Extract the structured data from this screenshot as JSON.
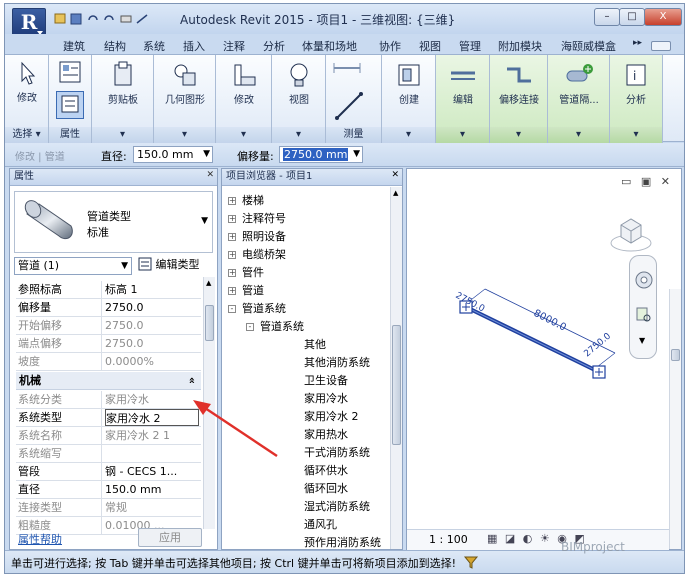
{
  "titlebar": {
    "title": "Autodesk Revit 2015 -     项目1 - 三维视图: {三维}",
    "app_logo": "R"
  },
  "window_controls": {
    "minimize": "–",
    "maximize": "□",
    "close": "X"
  },
  "tabs": [
    "建筑",
    "结构",
    "系统",
    "插入",
    "注释",
    "分析",
    "体量和场地",
    "协作",
    "视图",
    "管理",
    "附加模块",
    "海颐威模盒"
  ],
  "tab_overflow": "▸▸",
  "ribbon": {
    "groups": [
      {
        "label": "选择 ▾",
        "buttons": [
          "修改"
        ]
      },
      {
        "label": "属性",
        "buttons": []
      },
      {
        "label": "",
        "buttons": [
          "剪贴板"
        ]
      },
      {
        "label": "",
        "buttons": [
          "几何图形"
        ]
      },
      {
        "label": "",
        "buttons": [
          "修改"
        ]
      },
      {
        "label": "",
        "buttons": [
          "视图"
        ]
      },
      {
        "label": "测量",
        "buttons": []
      },
      {
        "label": "",
        "buttons": [
          "创建"
        ]
      },
      {
        "label": "",
        "buttons": [
          "编辑"
        ]
      },
      {
        "label": "",
        "buttons": [
          "偏移连接"
        ]
      },
      {
        "label": "",
        "buttons": [
          "管道隔..."
        ]
      },
      {
        "label": "",
        "buttons": [
          "分析"
        ]
      }
    ]
  },
  "options_bar": {
    "context": "修改 | 管道",
    "diameter_label": "直径:",
    "diameter_value": "150.0 mm",
    "offset_label": "偏移量:",
    "offset_value": "2750.0 mm"
  },
  "properties": {
    "title": "属性",
    "type_name": "管道类型",
    "type_sub": "标准",
    "instance_selector": "管道 (1)",
    "edit_type": "编辑类型",
    "rows_top": [
      {
        "k": "参照标高",
        "v": "标高 1",
        "gray": false
      },
      {
        "k": "偏移量",
        "v": "2750.0",
        "gray": false
      },
      {
        "k": "开始偏移",
        "v": "2750.0",
        "gray": true
      },
      {
        "k": "端点偏移",
        "v": "2750.0",
        "gray": true
      },
      {
        "k": "坡度",
        "v": "0.0000%",
        "gray": true
      }
    ],
    "section": "机械",
    "section_toggle": "»",
    "rows_mech": [
      {
        "k": "系统分类",
        "v": "家用冷水",
        "gray": true
      },
      {
        "k": "系统类型",
        "v": "家用冷水 2",
        "gray": false
      },
      {
        "k": "系统名称",
        "v": "家用冷水 2 1",
        "gray": true
      },
      {
        "k": "系统缩写",
        "v": "",
        "gray": true
      },
      {
        "k": "管段",
        "v": "钢 - CECS 1...",
        "gray": false
      },
      {
        "k": "直径",
        "v": "150.0 mm",
        "gray": false
      },
      {
        "k": "连接类型",
        "v": "常规",
        "gray": true
      },
      {
        "k": "粗糙度",
        "v": "0.01000 ...",
        "gray": true
      }
    ],
    "help": "属性帮助",
    "apply": "应用"
  },
  "browser": {
    "title": "项目浏览器 - 项目1",
    "items": [
      {
        "label": "楼梯",
        "level": 1,
        "expander": "+"
      },
      {
        "label": "注释符号",
        "level": 1,
        "expander": "+"
      },
      {
        "label": "照明设备",
        "level": 1,
        "expander": "+"
      },
      {
        "label": "电缆桥架",
        "level": 1,
        "expander": "+"
      },
      {
        "label": "管件",
        "level": 1,
        "expander": "+"
      },
      {
        "label": "管道",
        "level": 1,
        "expander": "+"
      },
      {
        "label": "管道系统",
        "level": 1,
        "expander": "-"
      },
      {
        "label": "管道系统",
        "level": 2,
        "expander": "-"
      },
      {
        "label": "其他",
        "level": 3,
        "expander": ""
      },
      {
        "label": "其他消防系统",
        "level": 3,
        "expander": ""
      },
      {
        "label": "卫生设备",
        "level": 3,
        "expander": ""
      },
      {
        "label": "家用冷水",
        "level": 3,
        "expander": ""
      },
      {
        "label": "家用冷水 2",
        "level": 3,
        "expander": ""
      },
      {
        "label": "家用热水",
        "level": 3,
        "expander": ""
      },
      {
        "label": "干式消防系统",
        "level": 3,
        "expander": ""
      },
      {
        "label": "循环供水",
        "level": 3,
        "expander": ""
      },
      {
        "label": "循环回水",
        "level": 3,
        "expander": ""
      },
      {
        "label": "湿式消防系统",
        "level": 3,
        "expander": ""
      },
      {
        "label": "通风孔",
        "level": 3,
        "expander": ""
      },
      {
        "label": "预作用消防系统",
        "level": 3,
        "expander": ""
      }
    ]
  },
  "viewport": {
    "dim_length": "8000.0",
    "dim_a": "2750.0",
    "dim_b": "2750.0",
    "scale": "1 : 100"
  },
  "statusbar": {
    "text": "单击可进行选择; 按 Tab 键并单击可选择其他项目; 按 Ctrl 键并单击可将新项目添加到选择!",
    "watermark": "BIMproject"
  },
  "colors": {
    "accent": "#2e5fa8",
    "ribbon_bg": "#c9daf0",
    "selection_blue": "#1f3f9e",
    "arrow_red": "#e0302a"
  }
}
